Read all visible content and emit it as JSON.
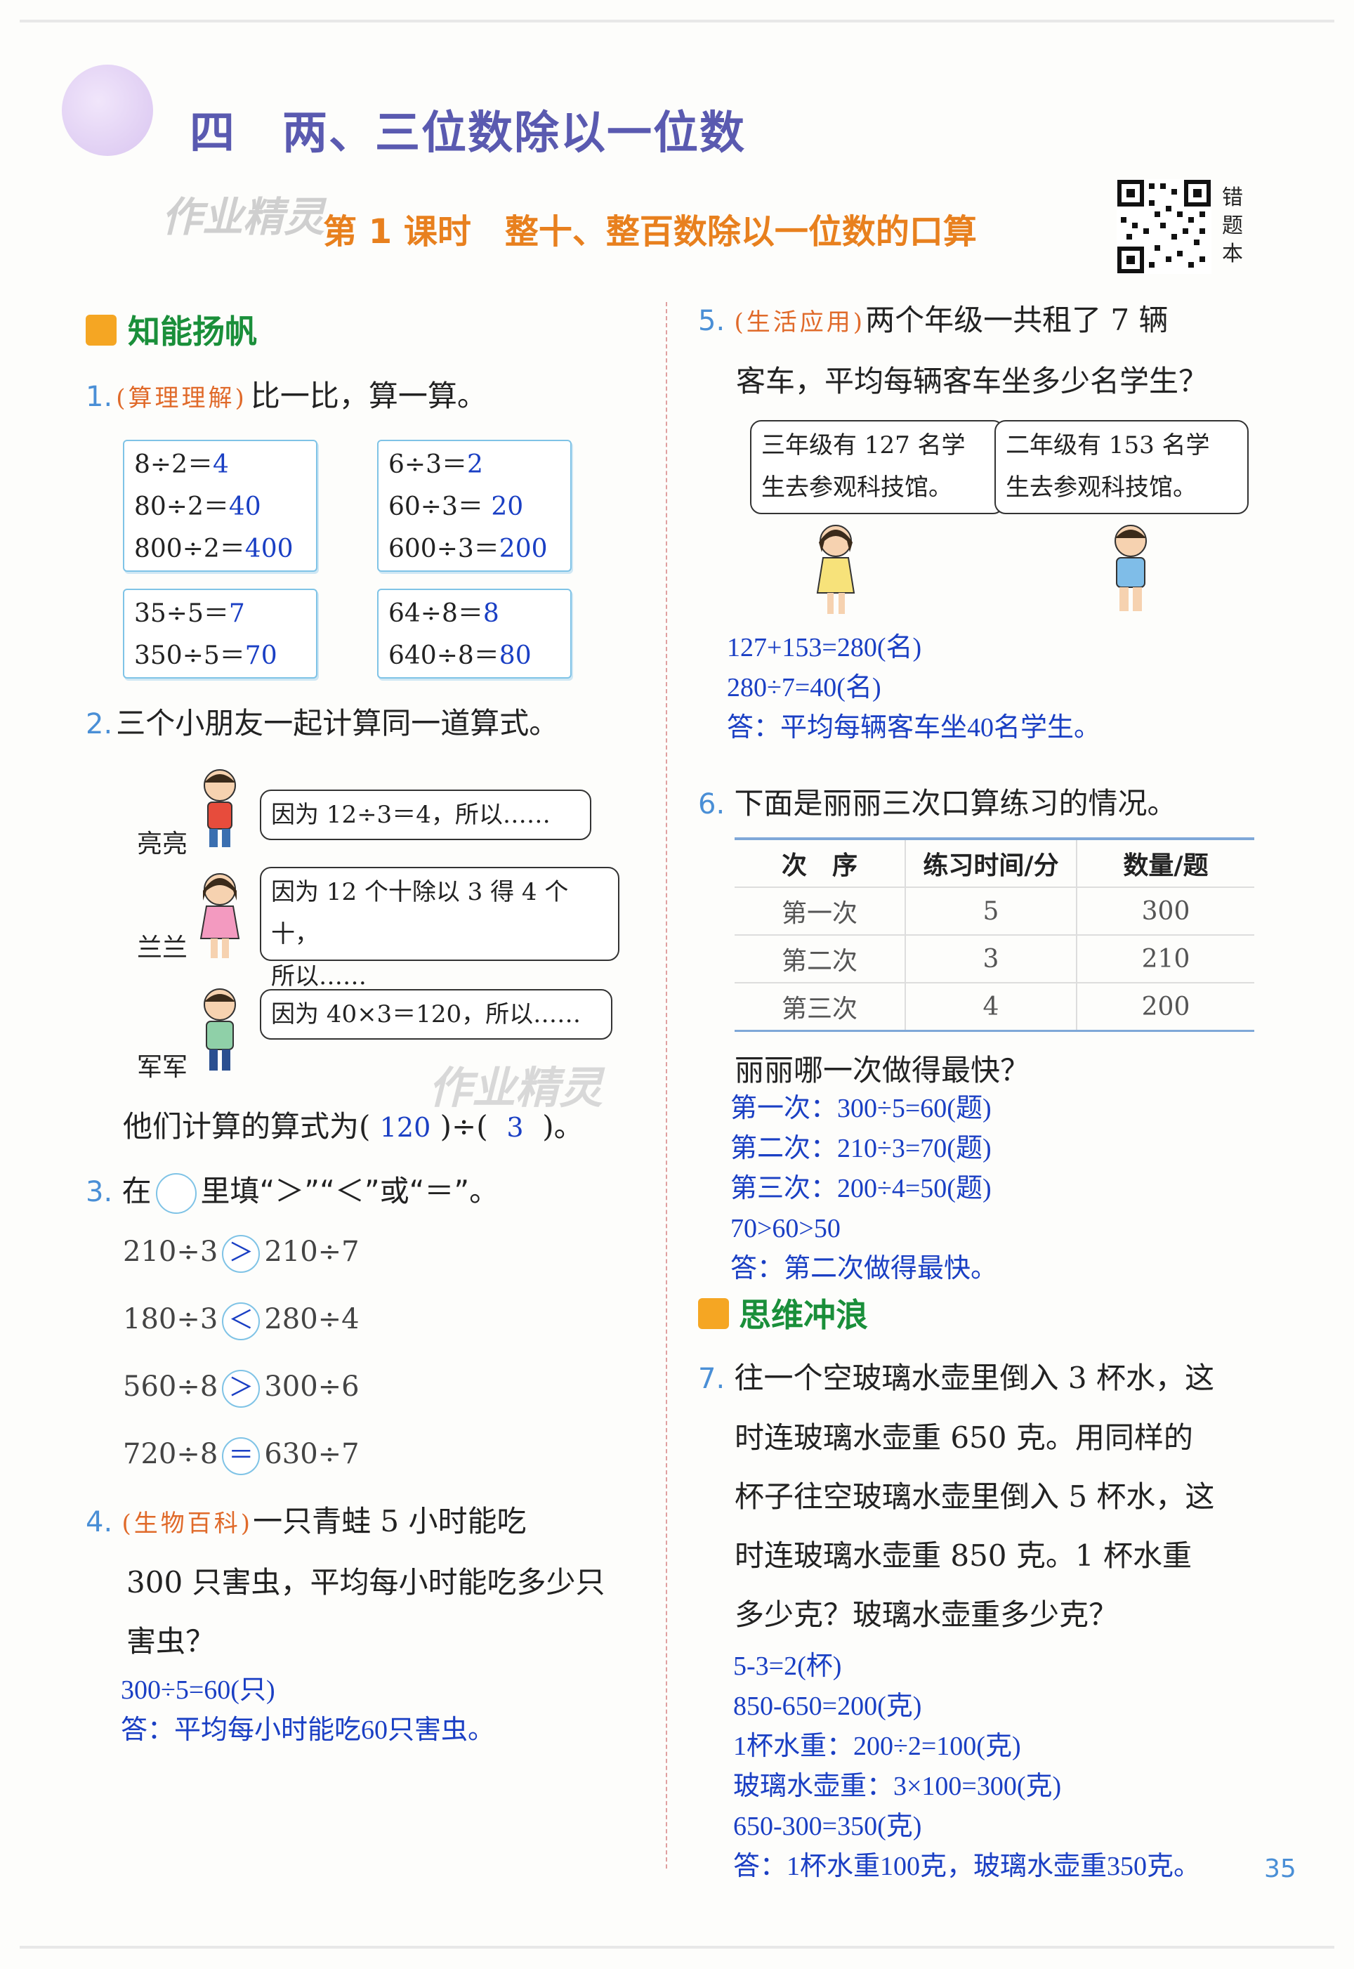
{
  "header": {
    "chapter": "四　两、三位数除以一位数",
    "lesson": "第 1 课时　整十、整百数除以一位数的口算",
    "watermark": "作业精灵",
    "qr_label": "错题本"
  },
  "sections": {
    "s1": "知能扬帆",
    "s2": "思维冲浪"
  },
  "q1": {
    "num": "1.",
    "tag": "(算理理解)",
    "text": "比一比，算一算。",
    "boxes": [
      [
        "8÷2＝",
        "4",
        "80÷2＝",
        "40",
        "800÷2＝",
        "400"
      ],
      [
        "6÷3＝",
        "2",
        "60÷3＝",
        "20",
        "600÷3＝",
        "200"
      ],
      [
        "35÷5＝",
        "7",
        "350÷5＝",
        "70"
      ],
      [
        "64÷8＝",
        "8",
        "640÷8＝",
        "80"
      ]
    ]
  },
  "q2": {
    "num": "2.",
    "text": "三个小朋友一起计算同一道算式。",
    "names": [
      "亮亮",
      "兰兰",
      "军军"
    ],
    "bubbles": [
      "因为 12÷3＝4，所以……",
      "因为 12 个十除以 3 得 4 个十，",
      "所以……",
      "因为 40×3＝120，所以……"
    ],
    "result_a": "他们计算的算式为(",
    "ans1": "120",
    "result_b": ")÷(",
    "ans2": "3",
    "result_c": ")。"
  },
  "q3": {
    "num": "3.",
    "text_a": "在",
    "text_b": "里填“＞”“＜”或“＝”。",
    "rows": [
      [
        "210÷3",
        "＞",
        "210÷7"
      ],
      [
        "180÷3",
        "＜",
        "280÷4"
      ],
      [
        "560÷8",
        "＞",
        "300÷6"
      ],
      [
        "720÷8",
        "＝",
        "630÷7"
      ]
    ]
  },
  "q4": {
    "num": "4.",
    "tag": "(生物百科)",
    "lines": [
      "一只青蛙 5 小时能吃",
      "300 只害虫，平均每小时能吃多少只",
      "害虫？"
    ],
    "answers": [
      "300÷5=60(只)",
      "答：平均每小时能吃60只害虫。"
    ]
  },
  "q5": {
    "num": "5.",
    "tag": "(生活应用)",
    "lines": [
      "两个年级一共租了 7 辆",
      "客车，平均每辆客车坐多少名学生？"
    ],
    "bubble_left": [
      "三年级有 127 名学",
      "生去参观科技馆。"
    ],
    "bubble_right": [
      "二年级有 153 名学",
      "生去参观科技馆。"
    ],
    "answers": [
      "127+153=280(名)",
      "280÷7=40(名)",
      "答：平均每辆客车坐40名学生。"
    ]
  },
  "q6": {
    "num": "6.",
    "text": "下面是丽丽三次口算练习的情况。",
    "headers": [
      "次　序",
      "练习时间/分",
      "数量/题"
    ],
    "rows": [
      [
        "第一次",
        "5",
        "300"
      ],
      [
        "第二次",
        "3",
        "210"
      ],
      [
        "第三次",
        "4",
        "200"
      ]
    ],
    "question": "丽丽哪一次做得最快？",
    "answers": [
      "第一次：300÷5=60(题)",
      "第二次：210÷3=70(题)",
      "第三次：200÷4=50(题)",
      "70>60>50",
      "答：第二次做得最快。"
    ]
  },
  "q7": {
    "num": "7.",
    "lines": [
      "往一个空玻璃水壶里倒入 3 杯水，这",
      "时连玻璃水壶重 650 克。用同样的",
      "杯子往空玻璃水壶里倒入 5 杯水，这",
      "时连玻璃水壶重 850 克。1 杯水重",
      "多少克？玻璃水壶重多少克？"
    ],
    "answers": [
      "5-3=2(杯)",
      "850-650=200(克)",
      "1杯水重：200÷2=100(克)",
      "玻璃水壶重：3×100=300(克)",
      "650-300=350(克)",
      "答：1杯水重100克，玻璃水壶重350克。"
    ]
  },
  "page_number": "35",
  "colors": {
    "answer": "#1a3fc4",
    "qnum": "#4a8fd6",
    "tag": "#e06a2a",
    "chapter": "#5a5ab0",
    "lesson": "#e8801e",
    "section": "#1a8f3a"
  }
}
